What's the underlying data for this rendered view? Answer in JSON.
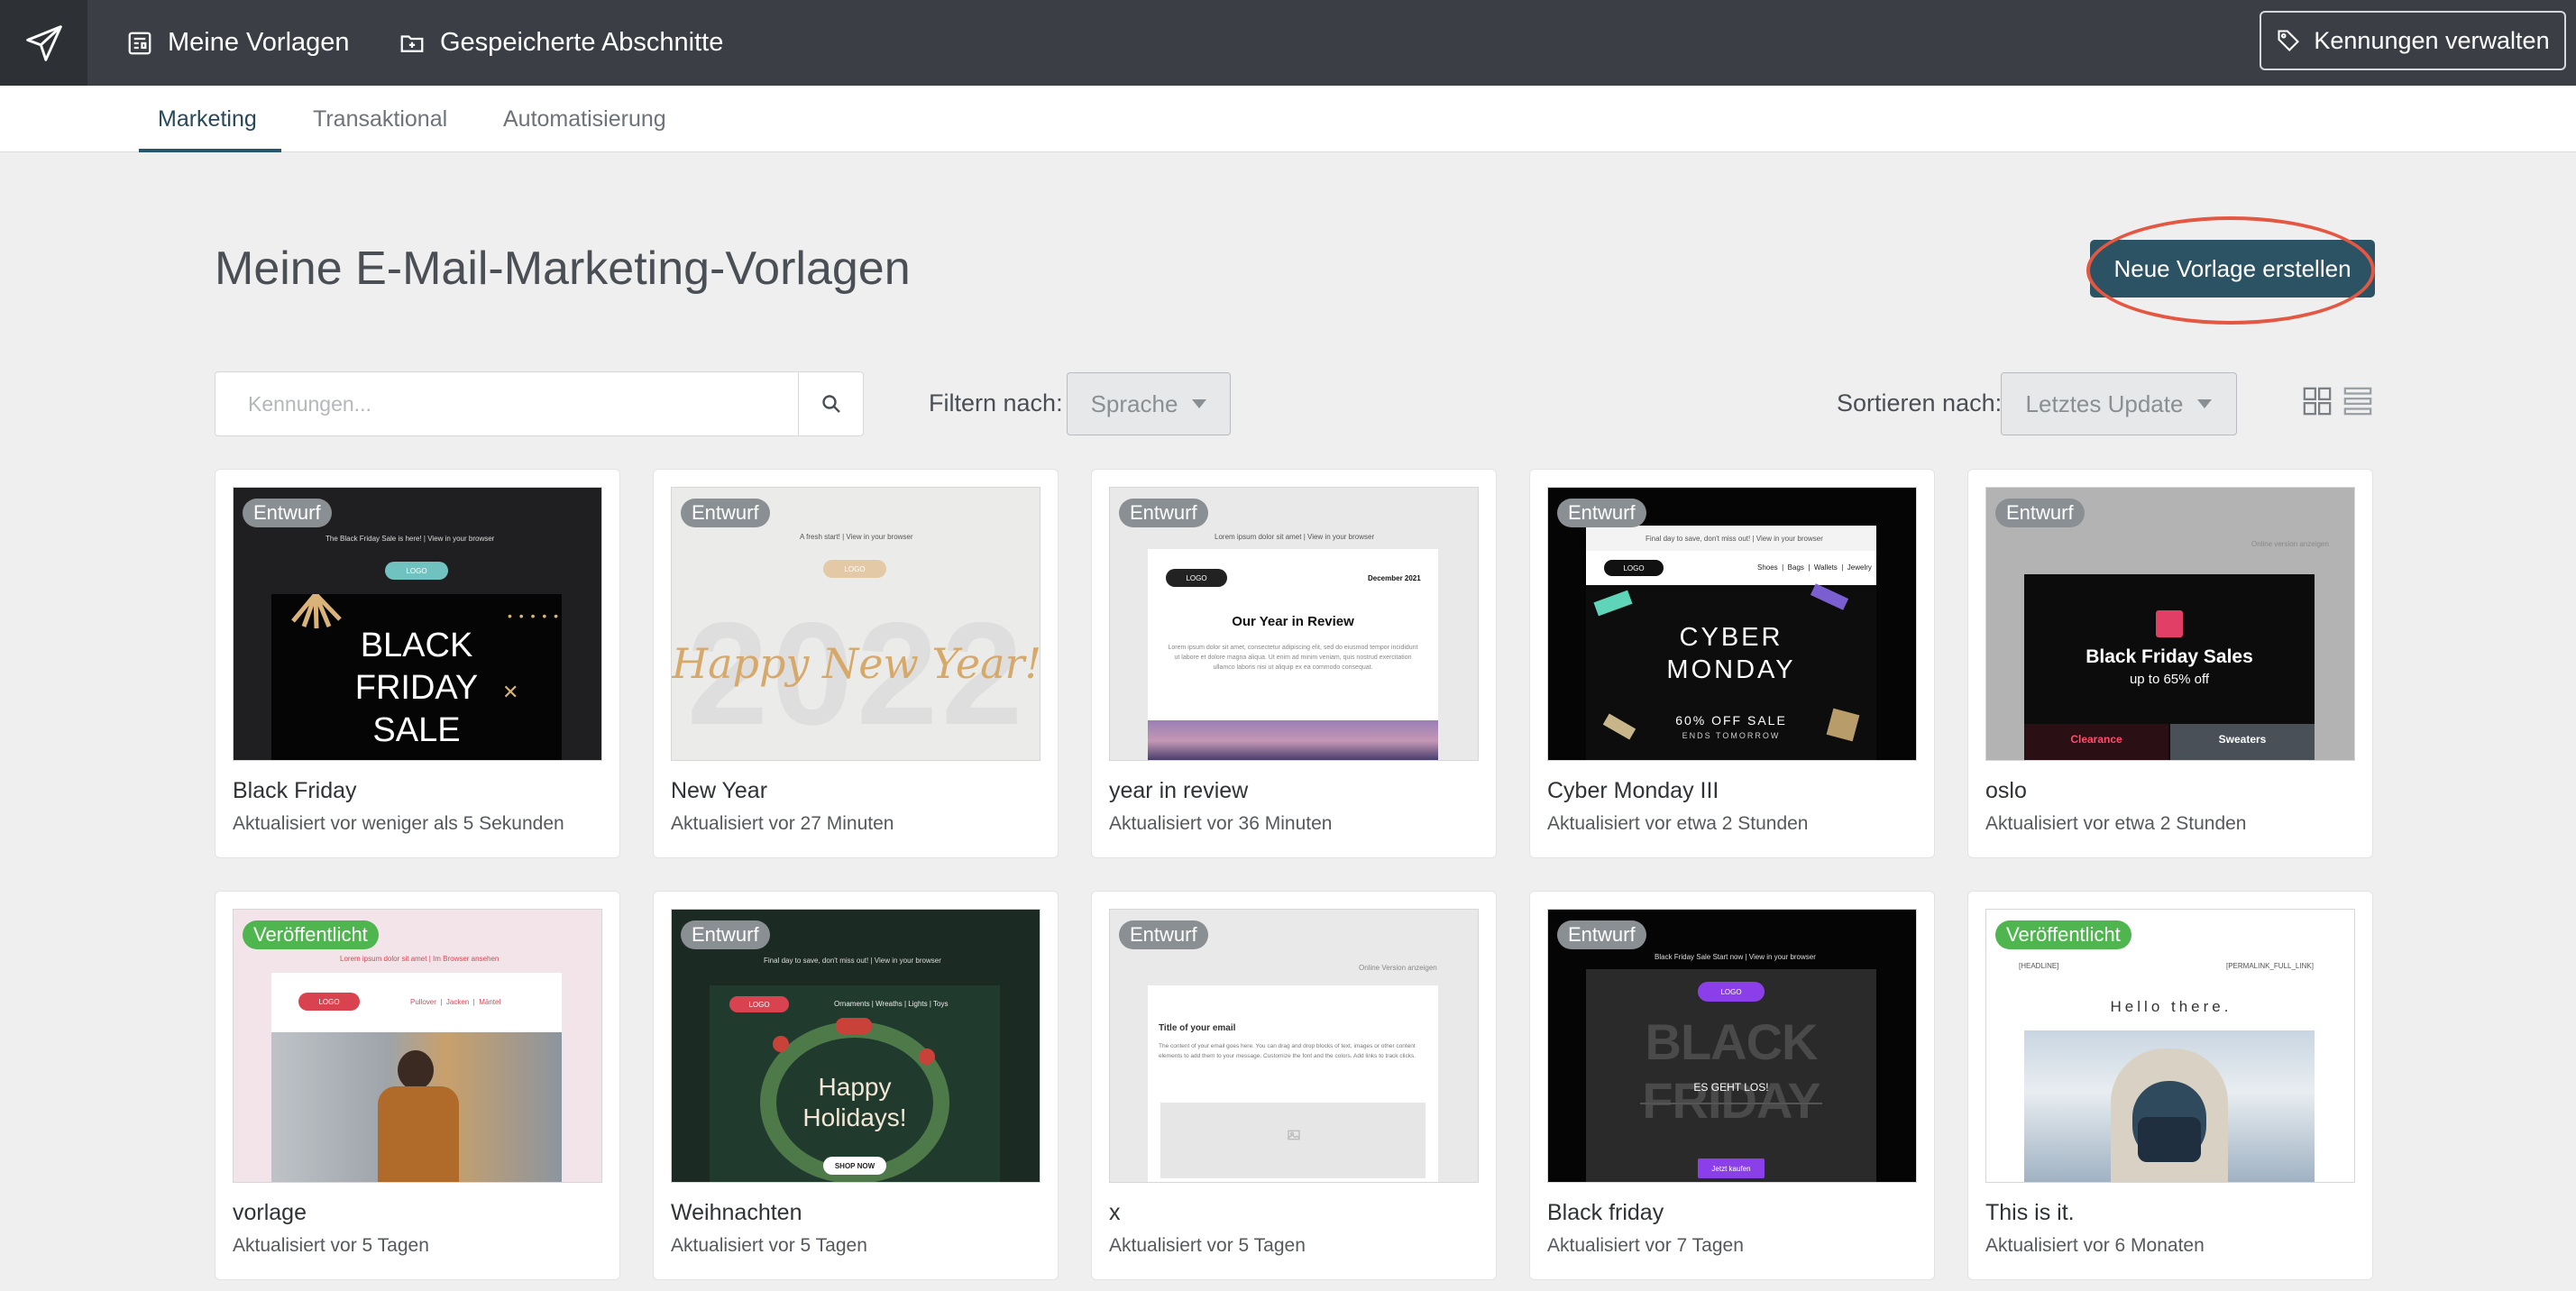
{
  "topbar": {
    "nav": [
      {
        "label": "Meine Vorlagen"
      },
      {
        "label": "Gespeicherte Abschnitte"
      }
    ],
    "manage_label": "Kennungen verwalten"
  },
  "tabs": [
    {
      "label": "Marketing",
      "active": true
    },
    {
      "label": "Transaktional",
      "active": false
    },
    {
      "label": "Automatisierung",
      "active": false
    }
  ],
  "page": {
    "title": "Meine E-Mail-Marketing-Vorlagen",
    "new_template_label": "Neue Vorlage erstellen"
  },
  "filters": {
    "search_placeholder": "Kennungen...",
    "filter_label": "Filtern nach:",
    "filter_value": "Sprache",
    "sort_label": "Sortieren nach:",
    "sort_value": "Letztes Update"
  },
  "colors": {
    "topbar": "#3b3f45",
    "primary": "#2c5364",
    "highlight": "#e45742",
    "draft_badge": "#8a8f94",
    "published_badge": "#4fb54f"
  },
  "templates": [
    {
      "name": "Black Friday",
      "updated": "Aktualisiert vor weniger als 5 Sekunden",
      "status": "Entwurf",
      "preview": {
        "top_text": "The Black Friday Sale is here! | View in your browser",
        "logo": "LOGO",
        "headline": [
          "BLACK",
          "FRIDAY",
          "SALE"
        ]
      }
    },
    {
      "name": "New Year",
      "updated": "Aktualisiert vor 27 Minuten",
      "status": "Entwurf",
      "preview": {
        "top_text": "A fresh start! | View in your browser",
        "logo": "LOGO",
        "year": "2022",
        "script": "Happy New Year!"
      }
    },
    {
      "name": "year in review",
      "updated": "Aktualisiert vor 36 Minuten",
      "status": "Entwurf",
      "preview": {
        "top_text": "Lorem ipsum dolor sit amet | View in your browser",
        "logo": "LOGO",
        "date": "December 2021",
        "heading": "Our Year in Review",
        "body": "Lorem ipsum dolor sit amet, consectetur adipiscing elit, sed do eiusmod tempor incididunt ut labore et dolore magna aliqua. Ut enim ad minim veniam, quis nostrud exercitation ullamco laboris nisi ut aliquip ex ea commodo consequat."
      }
    },
    {
      "name": "Cyber Monday III",
      "updated": "Aktualisiert vor etwa 2 Stunden",
      "status": "Entwurf",
      "preview": {
        "top_text": "Final day to save, don't miss out! | View in your browser",
        "logo": "LOGO",
        "menu": [
          "Shoes",
          "Bags",
          "Wallets",
          "Jewelry"
        ],
        "headline": [
          "CYBER",
          "MONDAY"
        ],
        "sub": "60% OFF SALE",
        "sub2": "ENDS TOMORROW"
      }
    },
    {
      "name": "oslo",
      "updated": "Aktualisiert vor etwa 2 Stunden",
      "status": "Entwurf",
      "preview": {
        "top_text": "Online version anzeigen",
        "heading": "Black Friday Sales",
        "sub": "up to 65% off",
        "left": "Clearance",
        "right": "Sweaters"
      }
    },
    {
      "name": "vorlage",
      "updated": "Aktualisiert vor 5 Tagen",
      "status": "Veröffentlicht",
      "preview": {
        "top_text": "Lorem ipsum dolor sit amet | Im Browser ansehen",
        "logo": "LOGO",
        "menu": [
          "Pullover",
          "Jacken",
          "Mäntel"
        ]
      }
    },
    {
      "name": "Weihnachten",
      "updated": "Aktualisiert vor 5 Tagen",
      "status": "Entwurf",
      "preview": {
        "top_text": "Final day to save, don't miss out! | View in your browser",
        "logo": "LOGO",
        "menu": [
          "Ornaments",
          "Wreaths",
          "Lights",
          "Toys"
        ],
        "headline": [
          "Happy",
          "Holidays!"
        ],
        "cta": "SHOP NOW"
      }
    },
    {
      "name": "x",
      "updated": "Aktualisiert vor 5 Tagen",
      "status": "Entwurf",
      "preview": {
        "top_text": "Online Version anzeigen",
        "heading": "Title of your email",
        "body": "The content of your email goes here. You can drag and drop blocks of text, images or other content elements to add them to your message. Customize the font and the colors. Add links to track clicks."
      }
    },
    {
      "name": "Black friday",
      "updated": "Aktualisiert vor 7 Tagen",
      "status": "Entwurf",
      "preview": {
        "top_text": "Black Friday Sale Start now | View in your browser",
        "logo": "LOGO",
        "headline": "BLACK FRIDAY",
        "sub": "ES GEHT LOS!",
        "cta": "Jetzt kaufen"
      }
    },
    {
      "name": "This is it.",
      "updated": "Aktualisiert vor 6 Monaten",
      "status": "Veröffentlicht",
      "preview": {
        "top_left": "[HEADLINE]",
        "top_right": "[PERMALINK_FULL_LINK]",
        "heading": "Hello there."
      }
    }
  ]
}
